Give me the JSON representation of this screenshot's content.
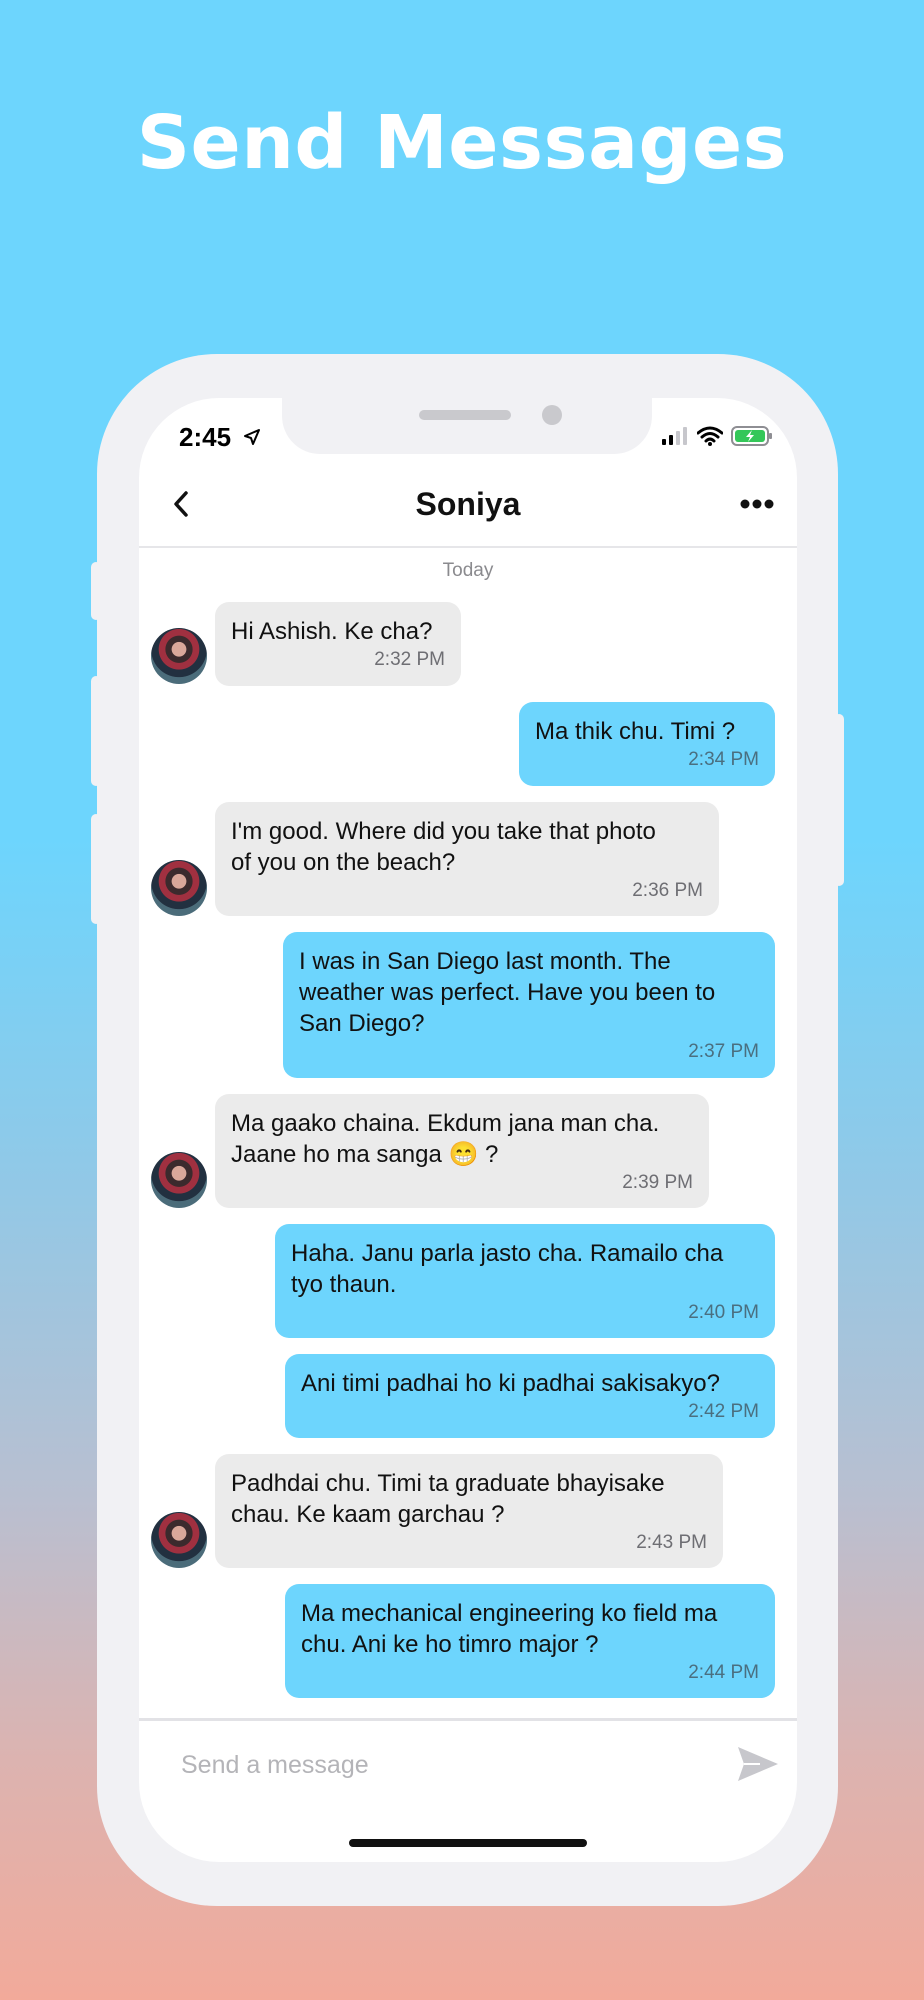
{
  "headline": "Send Messages",
  "status_bar": {
    "time": "2:45"
  },
  "nav": {
    "title": "Soniya"
  },
  "chat": {
    "date_label": "Today",
    "messages": [
      {
        "dir": "in",
        "text": "Hi Ashish. Ke cha?",
        "time": "2:32 PM"
      },
      {
        "dir": "out",
        "text": "Ma thik chu. Timi ?",
        "time": "2:34 PM"
      },
      {
        "dir": "in",
        "text": "I'm good. Where did you take that photo\nof you on the beach?",
        "time": "2:36 PM"
      },
      {
        "dir": "out",
        "text": "I was in San Diego last month. The\nweather was perfect. Have you been to\nSan Diego?",
        "time": "2:37 PM"
      },
      {
        "dir": "in",
        "text": "Ma gaako chaina. Ekdum jana man cha.\nJaane ho ma sanga 😁 ?",
        "time": "2:39 PM"
      },
      {
        "dir": "out",
        "text": "Haha. Janu parla jasto cha. Ramailo cha\ntyo thaun.",
        "time": "2:40 PM"
      },
      {
        "dir": "out",
        "text": "Ani timi padhai ho ki padhai sakisakyo?",
        "time": "2:42 PM"
      },
      {
        "dir": "in",
        "text": "Padhdai chu. Timi ta graduate bhayisake\nchau. Ke kaam garchau ?",
        "time": "2:43 PM"
      },
      {
        "dir": "out",
        "text": "Ma mechanical engineering ko field ma\nchu. Ani ke ho timro major ?",
        "time": "2:44 PM"
      }
    ]
  },
  "composer": {
    "placeholder": "Send a message",
    "value": ""
  },
  "colors": {
    "outgoing_bubble": "#6dd5fd",
    "incoming_bubble": "#ebebeb",
    "accent": "#6dd5fd"
  },
  "icons": [
    "location-arrow-icon",
    "signal-icon",
    "wifi-icon",
    "battery-icon",
    "chevron-left-icon",
    "more-icon",
    "send-icon"
  ]
}
